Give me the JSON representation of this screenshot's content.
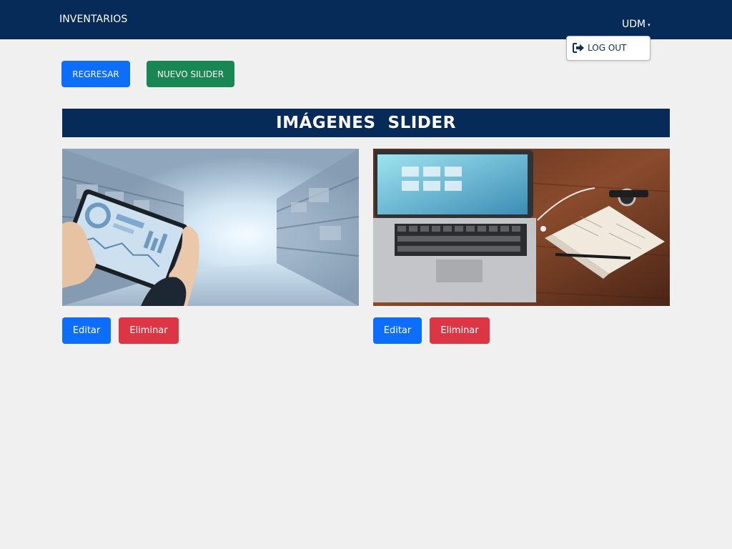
{
  "navbar": {
    "brand": "INVENTARIOS",
    "user_label": "UDM",
    "caret": "▾",
    "user_menu": {
      "logout_label": "LOG OUT",
      "logout_icon": "sign-out-icon"
    }
  },
  "toolbar": {
    "back_label": "REGRESAR",
    "new_slider_label": "NUEVO SILIDER"
  },
  "page_title": "IMÁGENES  SLIDER",
  "slides": [
    {
      "image_alt": "warehouse-tablet-analytics-image",
      "edit_label": "Editar",
      "delete_label": "Eliminar"
    },
    {
      "image_alt": "laptop-notebook-desk-image",
      "edit_label": "Editar",
      "delete_label": "Eliminar"
    }
  ],
  "colors": {
    "navbar": "#062b58",
    "primary": "#0d6efd",
    "success": "#198754",
    "danger": "#dc3545",
    "background": "#f0f0f0"
  }
}
